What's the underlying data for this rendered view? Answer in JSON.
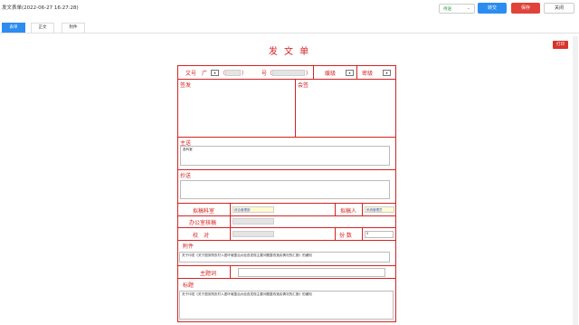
{
  "header": {
    "title": "发文表单(2022-06-27 16:27:28)",
    "status_select": "待送",
    "send_label": "转交",
    "save_label": "保存",
    "close_label": "关闭"
  },
  "tabs": [
    {
      "label": "表单"
    },
    {
      "label": "正文"
    },
    {
      "label": "附件"
    }
  ],
  "print_label": "打印",
  "form": {
    "title": "发 文 单",
    "doc_no_label": "文号",
    "doc_word": "广",
    "paren_open": "（",
    "paren_close": "）",
    "number_label": "号",
    "urgency_label": "缓级",
    "secret_label": "密级",
    "sign_label": "签发",
    "countersign_label": "会签",
    "main_to_label": "主送",
    "main_to_value": "各科室",
    "cc_label": "抄送",
    "draft_dept_label": "拟稿科室",
    "draft_dept_value": "综合管理部",
    "drafter_label": "拟稿人",
    "drafter_value": "系统管理员",
    "office_check_label": "办公室核稿",
    "proofread_label": "校　对",
    "copies_label": "份 数",
    "copies_value": "5",
    "attachment_label": "附件",
    "attachment_value": "关于印发《关于国务院农村人居环境整治大检查发现主要问题整改落实情况的汇报》的通知",
    "subject_label": "主题词",
    "heading_label": "标题",
    "heading_value": "关于印发《关于国务院农村人居环境整治大检查发现主要问题整改落实情况的汇报》的通知"
  }
}
